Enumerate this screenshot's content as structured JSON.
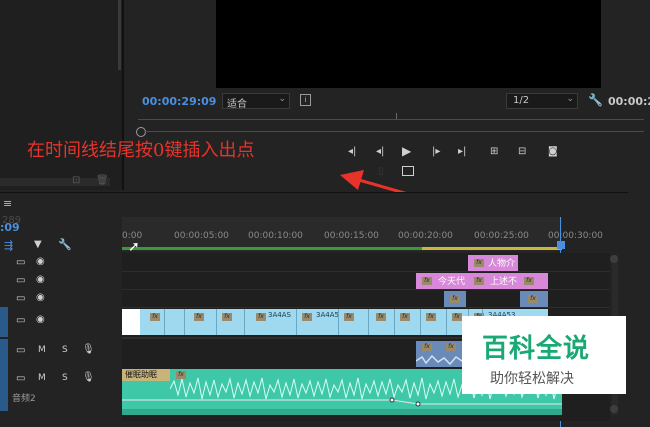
{
  "source_monitor": {
    "timecode": "00:00:29:09",
    "fit_label": "适合",
    "resolution": "1/2",
    "right_timecode": "00:00:2"
  },
  "annotation": {
    "text": "在时间线结尾按0键插入出点"
  },
  "timeline": {
    "sequence_name": "289",
    "playhead_timecode": ":09",
    "ruler_labels": [
      "0:00",
      "00:00:05:00",
      "00:00:10:00",
      "00:00:15:00",
      "00:00:20:00",
      "00:00:25:00",
      "00:00:30:00"
    ],
    "track_buttons": [
      "M",
      "S"
    ],
    "audio_track_label": "音频2",
    "clip_labels": {
      "clip_a": "3A4AS",
      "clip_b": "3A4A5",
      "clip_c": "3A4A53",
      "title_1": "人物介",
      "title_2": "今天代",
      "title_3": "上述不",
      "audio_clip": "催眠助眠"
    }
  },
  "watermark": {
    "title": "百科全说",
    "subtitle": "助你轻松解决"
  },
  "colors": {
    "accent_blue": "#4a8fe0",
    "annotation_red": "#e8332a",
    "video_clip": "#9fd9f0",
    "title_clip": "#d888d8",
    "audio_clip": "#3ec8a8"
  }
}
